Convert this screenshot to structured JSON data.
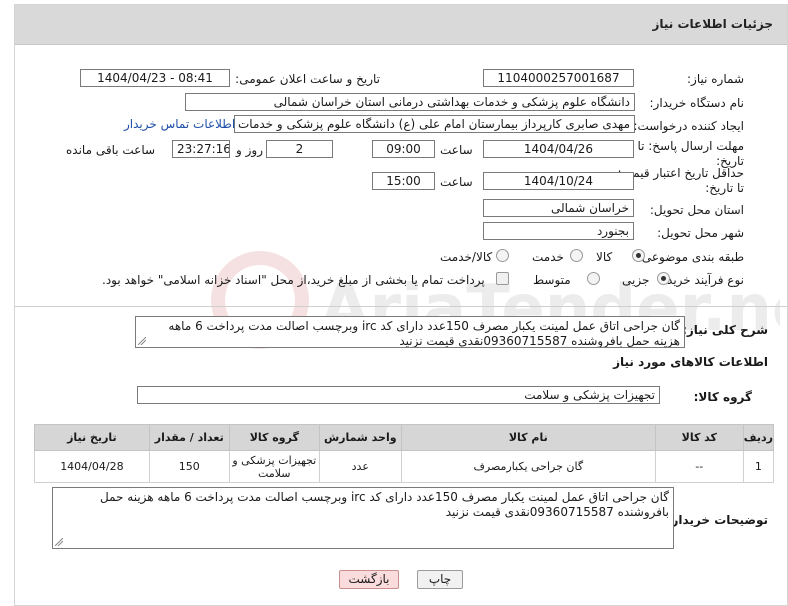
{
  "header": {
    "title": "جزئیات اطلاعات نیاز"
  },
  "labels": {
    "need_number": "شماره نیاز:",
    "announce_datetime": "تاریخ و ساعت اعلان عمومی:",
    "buyer_org": "نام دستگاه خریدار:",
    "requester": "ایجاد کننده درخواست:",
    "deadline": "مهلت ارسال پاسخ: تا تاریخ:",
    "hour": "ساعت",
    "day_and": "روز و",
    "remaining": "ساعت باقی مانده",
    "min_validity": "حداقل تاریخ اعتبار قیمت: تا تاریخ:",
    "delivery_province": "استان محل تحویل:",
    "delivery_city": "شهر محل تحویل:",
    "category": "طبقه بندی موضوعی:",
    "process_type": "نوع فرآیند خرید :",
    "need_summary": "شرح کلی نیاز:",
    "goods_info": "اطلاعات کالاهای مورد نیاز",
    "goods_group": "گروه کالا:",
    "buyer_notes": "توضیحات خریدار:"
  },
  "fields": {
    "need_number": "1104000257001687",
    "announce_datetime": "1404/04/23 - 08:41",
    "buyer_org": "دانشگاه علوم پزشکی و خدمات بهداشتی درمانی استان خراسان شمالی",
    "requester": "مهدی صابری کارپرداز بیمارستان امام علی (ع) دانشگاه علوم پزشکی و خدمات بهداشتی درمانی",
    "contact_link": "اطلاعات تماس خریدار",
    "deadline_date": "1404/04/26",
    "deadline_time": "09:00",
    "days_left": "2",
    "time_left": "23:27:16",
    "validity_date": "1404/10/24",
    "validity_time": "15:00",
    "province": "خراسان شمالی",
    "city": "بجنورد",
    "need_summary": "گان جراحی اتاق عمل لمینت یکبار مصرف 150عدد دارای کد irc وبرچسب اصالت مدت پرداخت 6 ماهه هزینه حمل بافروشنده 09360715587نقدی قیمت نزنید",
    "goods_group": "تجهیزات پزشکی و سلامت",
    "buyer_notes": "گان جراحی اتاق عمل لمینت یکبار مصرف 150عدد دارای کد irc وبرچسب اصالت مدت پرداخت 6 ماهه هزینه حمل بافروشنده 09360715587نقدی قیمت نزنید"
  },
  "category_options": [
    {
      "label": "کالا",
      "selected": true
    },
    {
      "label": "خدمت",
      "selected": false
    },
    {
      "label": "کالا/خدمت",
      "selected": false
    }
  ],
  "process_options": [
    {
      "label": "جزیی",
      "selected": true
    },
    {
      "label": "متوسط",
      "selected": false
    }
  ],
  "payment_note": "پرداخت تمام یا بخشی از مبلغ خرید،از محل \"اسناد خزانه اسلامی\" خواهد بود.",
  "table": {
    "headers": [
      "ردیف",
      "کد کالا",
      "نام کالا",
      "واحد شمارش",
      "گروه کالا",
      "تعداد / مقدار",
      "تاریخ نیاز"
    ],
    "rows": [
      [
        "1",
        "--",
        "گان جراحی یکبارمصرف",
        "عدد",
        "تجهیزات پزشکی و سلامت",
        "150",
        "1404/04/28"
      ]
    ]
  },
  "buttons": {
    "print": "چاپ",
    "back": "بازگشت"
  },
  "watermark": "AriaTender.net"
}
